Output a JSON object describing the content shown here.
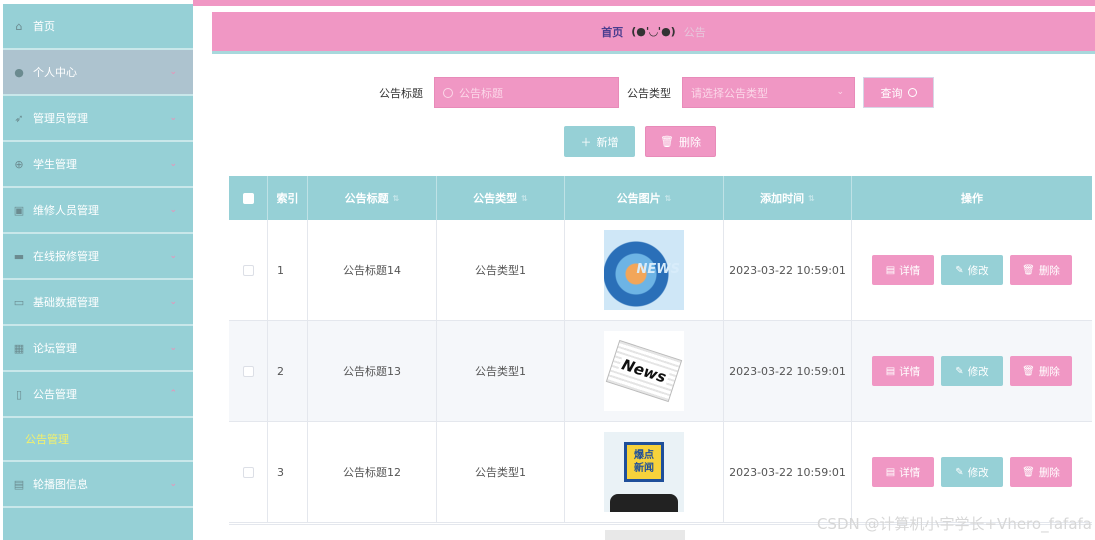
{
  "sidebar": {
    "items": [
      {
        "label": "首页",
        "icon": "home-icon",
        "glyph": "⌂",
        "chev": ""
      },
      {
        "label": "个人中心",
        "icon": "user-icon",
        "glyph": "●",
        "chev": "⌄"
      },
      {
        "label": "管理员管理",
        "icon": "send-icon",
        "glyph": "➶",
        "chev": "⌄"
      },
      {
        "label": "学生管理",
        "icon": "compass-icon",
        "glyph": "⊕",
        "chev": "⌄"
      },
      {
        "label": "维修人员管理",
        "icon": "clipboard-icon",
        "glyph": "▣",
        "chev": "⌄"
      },
      {
        "label": "在线报修管理",
        "icon": "message-icon",
        "glyph": "▬",
        "chev": "⌄"
      },
      {
        "label": "基础数据管理",
        "icon": "monitor-icon",
        "glyph": "▭",
        "chev": "⌄"
      },
      {
        "label": "论坛管理",
        "icon": "grid-icon",
        "glyph": "▦",
        "chev": "⌄"
      },
      {
        "label": "公告管理",
        "icon": "mic-icon",
        "glyph": "▯",
        "chev": "⌃"
      }
    ],
    "subitem": "公告管理",
    "last_item": {
      "label": "轮播图信息",
      "icon": "document-icon",
      "glyph": "▤",
      "chev": "⌄"
    }
  },
  "breadcrumb": {
    "home": "首页",
    "face": "(●'◡'●)",
    "current": "公告"
  },
  "search": {
    "title_label": "公告标题",
    "title_placeholder": "公告标题",
    "type_label": "公告类型",
    "type_placeholder": "请选择公告类型",
    "query_button": "查询"
  },
  "toolbar": {
    "add_button": "新增",
    "delete_button": "删除"
  },
  "table": {
    "headers": {
      "index": "索引",
      "title": "公告标题",
      "type": "公告类型",
      "image": "公告图片",
      "time": "添加时间",
      "actions": "操作"
    },
    "rows": [
      {
        "index": "1",
        "title": "公告标题14",
        "type": "公告类型1",
        "image_text": "NEWS",
        "time": "2023-03-22 10:59:01"
      },
      {
        "index": "2",
        "title": "公告标题13",
        "type": "公告类型1",
        "image_text": "News",
        "time": "2023-03-22 10:59:01"
      },
      {
        "index": "3",
        "title": "公告标题12",
        "type": "公告类型1",
        "image_text_1": "爆点",
        "image_text_2": "新闻",
        "time": "2023-03-22 10:59:01"
      }
    ],
    "actions": {
      "detail": "详情",
      "edit": "修改",
      "delete": "删除"
    }
  },
  "watermark": "CSDN @计算机小宇学长+Vhero_fafafa",
  "colors": {
    "pink": "#f097c4",
    "teal": "#96d0d6",
    "submenu_text": "#f4f06a"
  }
}
